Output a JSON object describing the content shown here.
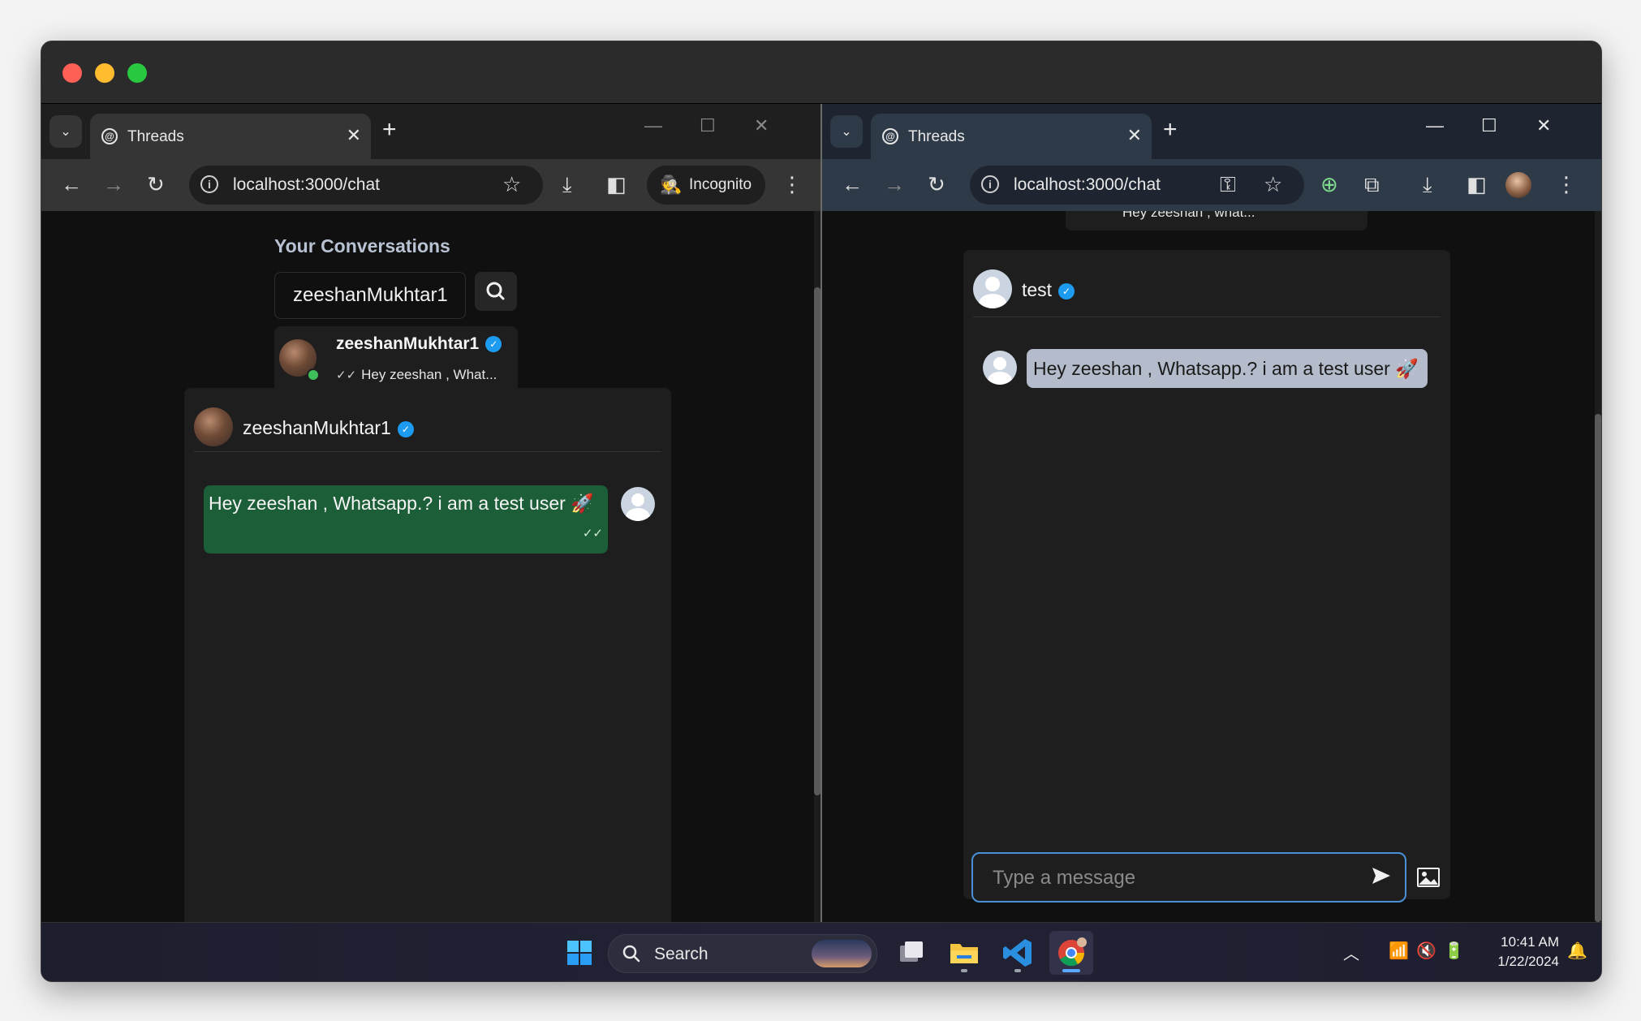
{
  "left_window": {
    "tab_title": "Threads",
    "url": "localhost:3000/chat",
    "incognito_label": "Incognito",
    "sidebar": {
      "title": "Your Conversations",
      "search_value": "zeeshanMukhtar1",
      "conversations": [
        {
          "name": "zeeshanMukhtar1",
          "preview": "Hey zeeshan , What...",
          "online": true,
          "verified": true
        }
      ]
    },
    "chat": {
      "partner_name": "zeeshanMukhtar1",
      "messages": [
        {
          "text": "Hey zeeshan , Whatsapp.? i am a test user 🚀",
          "own": true,
          "seen": true
        }
      ]
    }
  },
  "right_window": {
    "tab_title": "Threads",
    "url": "localhost:3000/chat",
    "peek_preview": "Hey zeesnan , wnat...",
    "chat": {
      "partner_name": "test",
      "messages": [
        {
          "text": "Hey zeeshan , Whatsapp.? i am a test user 🚀",
          "own": false
        }
      ],
      "input_placeholder": "Type a message"
    }
  },
  "taskbar": {
    "search_label": "Search",
    "time": "10:41 AM",
    "date": "1/22/2024"
  },
  "colors": {
    "own_bubble": "#1c5e38",
    "other_bubble": "#b4bccb",
    "verified": "#1d9bf0",
    "online": "#3fbf5a",
    "input_focus": "#4a90d9"
  }
}
